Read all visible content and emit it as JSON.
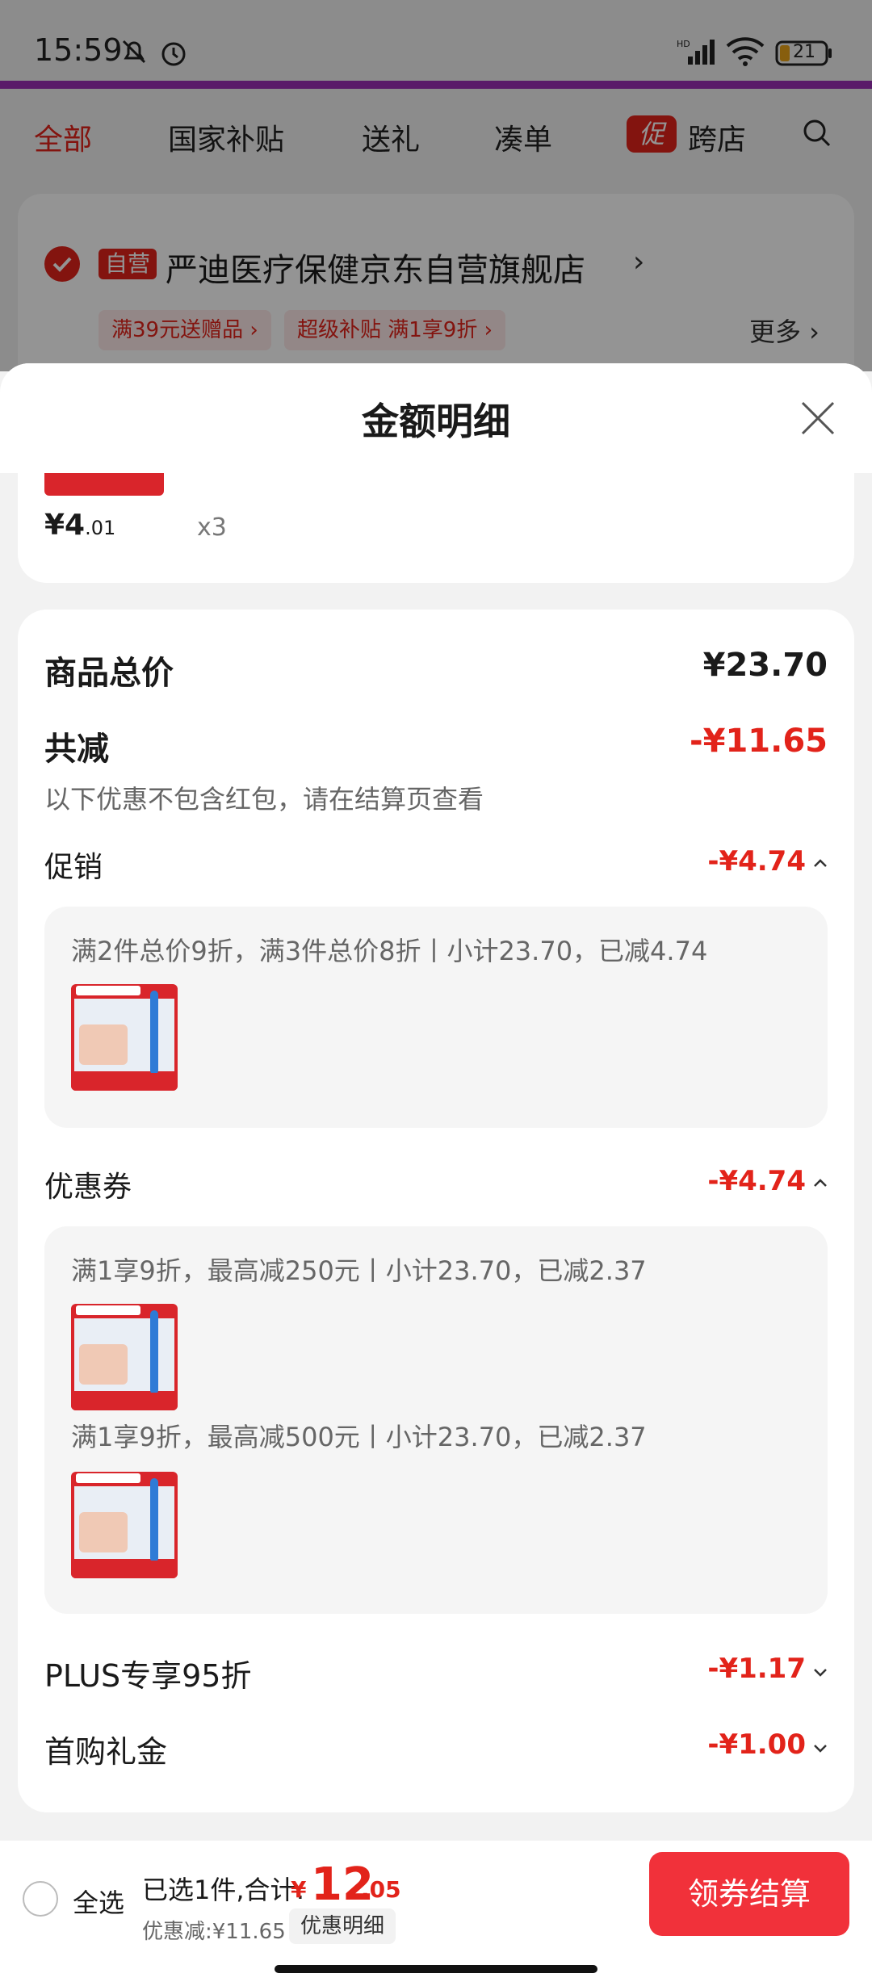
{
  "status_bar": {
    "time": "15:59",
    "battery": "21"
  },
  "tabs": [
    "全部",
    "国家补贴",
    "送礼",
    "凑单",
    "跨店"
  ],
  "promo_badge": "促",
  "shop": {
    "self_operated_badge": "自营",
    "name": "严迪医疗保健京东自营旗舰店",
    "chevron": "›",
    "chips": [
      "满39元送赠品 ›",
      "超级补贴 满1享9折 ›"
    ],
    "more": "更多 ›"
  },
  "sheet": {
    "title": "金额明细",
    "item": {
      "price_main": "¥4",
      "price_dec": ".01",
      "qty": "x3"
    },
    "total_label": "商品总价",
    "total_value": "¥23.70",
    "reduce_label": "共减",
    "reduce_value": "-¥11.65",
    "reduce_note": "以下优惠不包含红包，请在结算页查看",
    "promo": {
      "label": "促销",
      "value": "-¥4.74",
      "detail": "满2件总价9折，满3件总价8折丨小计23.70，已减4.74"
    },
    "coupon": {
      "label": "优惠券",
      "value": "-¥4.74",
      "details": [
        "满1享9折，最高减250元丨小计23.70，已减2.37",
        "满1享9折，最高减500元丨小计23.70，已减2.37"
      ]
    },
    "plus": {
      "label": "PLUS专享95折",
      "value": "-¥1.17"
    },
    "gift": {
      "label": "首购礼金",
      "value": "-¥1.00"
    }
  },
  "bottom": {
    "select_all": "全选",
    "selected": "已选1件,合计:",
    "yen": "¥",
    "total_int": "12",
    "total_dec": ".05",
    "discount": "优惠减:¥11.65",
    "detail_button": "优惠明细",
    "checkout": "领券结算"
  },
  "colors": {
    "accent": "#e2231a",
    "purple": "#9c2fb6",
    "checkout": "#f1313a"
  }
}
